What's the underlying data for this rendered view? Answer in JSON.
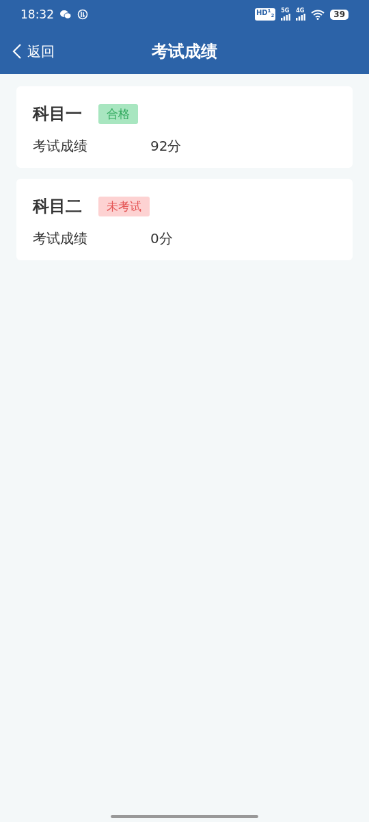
{
  "status_bar": {
    "time": "18:32",
    "hd": "HD$^{1}$$_{2}$",
    "networks": [
      "5G",
      "4G"
    ],
    "battery": "39"
  },
  "nav": {
    "back": "返回",
    "title": "考试成绩"
  },
  "subjects": [
    {
      "name": "科目一",
      "tag": "合格",
      "kind": "pass",
      "label": "考试成绩",
      "score": "92分"
    },
    {
      "name": "科目二",
      "tag": "未考试",
      "kind": "absent",
      "label": "考试成绩",
      "score": "0分"
    }
  ]
}
